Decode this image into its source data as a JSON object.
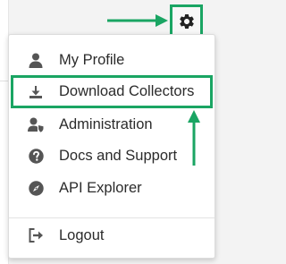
{
  "menu": {
    "items": [
      {
        "label": "My Profile",
        "icon": "user-icon"
      },
      {
        "label": "Download Collectors",
        "icon": "download-icon"
      },
      {
        "label": "Administration",
        "icon": "admin-user-icon"
      },
      {
        "label": "Docs and Support",
        "icon": "help-icon"
      },
      {
        "label": "API Explorer",
        "icon": "compass-icon"
      },
      {
        "label": "Logout",
        "icon": "logout-icon"
      }
    ]
  },
  "colors": {
    "highlight": "#1aa563",
    "icon": "#555555",
    "text": "#2b2b2b"
  }
}
